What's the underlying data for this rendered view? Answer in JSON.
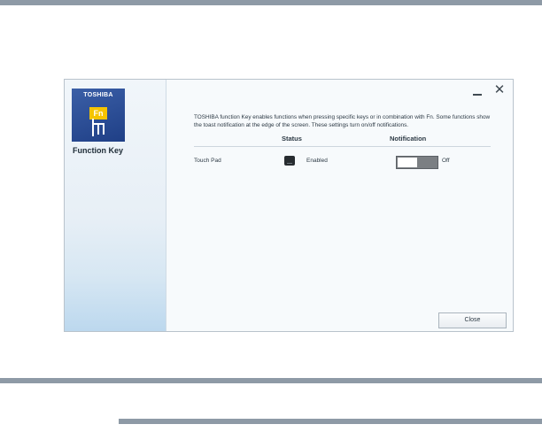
{
  "app": {
    "brand": "TOSHIBA",
    "badge": "Fn",
    "name": "Function Key"
  },
  "window_controls": {
    "minimize_icon": "minimize-icon",
    "close_glyph": "✕"
  },
  "description": "TOSHIBA function Key enables functions when pressing specific keys or in combination with Fn. Some functions show the toast notification at the edge of the screen. These settings turn on/off notifications.",
  "table": {
    "columns": [
      "Status",
      "Notification"
    ],
    "rows": [
      {
        "label": "Touch Pad",
        "status_icon": "touchpad-icon",
        "status": "Enabled",
        "notification": "Off",
        "notification_on": false
      }
    ]
  },
  "footer": {
    "close_label": "Close"
  },
  "colors": {
    "tile": "#2a4c96",
    "badge": "#f5c400",
    "toggle_track": "#7b7f83"
  }
}
